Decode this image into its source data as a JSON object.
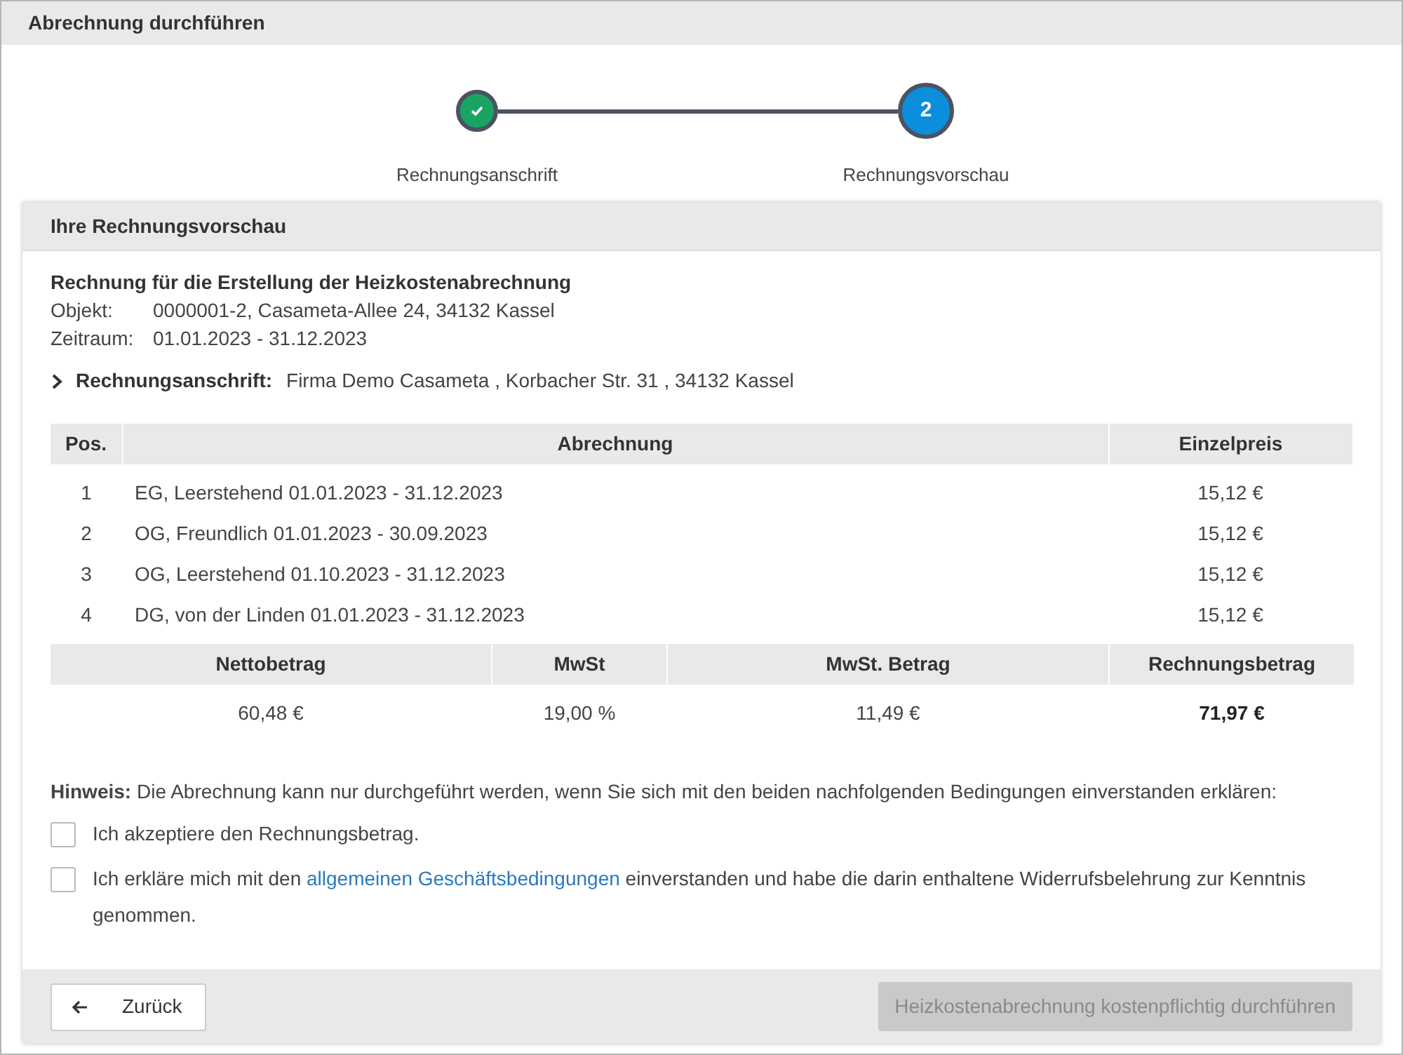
{
  "window": {
    "title": "Abrechnung durchführen"
  },
  "steps": [
    {
      "label": "Rechnungsanschrift",
      "completed": true
    },
    {
      "label": "Rechnungsvorschau",
      "completed": false,
      "number": "2"
    }
  ],
  "panel": {
    "title": "Ihre Rechnungsvorschau",
    "heading": "Rechnung für die Erstellung der Heizkostenabrechnung",
    "details": [
      {
        "label": "Objekt:",
        "value": "0000001-2, Casameta-Allee 24, 34132 Kassel"
      },
      {
        "label": "Zeitraum:",
        "value": "01.01.2023 - 31.12.2023"
      }
    ],
    "address": {
      "label": "Rechnungsanschrift:",
      "value": "Firma Demo Casameta , Korbacher Str. 31 , 34132 Kassel",
      "expanded": false
    }
  },
  "table": {
    "columns": [
      "Pos.",
      "Abrechnung",
      "Einzelpreis"
    ],
    "rows": [
      [
        "1",
        "EG, Leerstehend 01.01.2023 - 31.12.2023",
        "15,12 €"
      ],
      [
        "2",
        "OG, Freundlich 01.01.2023 - 30.09.2023",
        "15,12 €"
      ],
      [
        "3",
        "OG, Leerstehend 01.10.2023 - 31.12.2023",
        "15,12 €"
      ],
      [
        "4",
        "DG, von der Linden 01.01.2023 - 31.12.2023",
        "15,12 €"
      ]
    ]
  },
  "summary": {
    "columns": [
      "Nettobetrag",
      "MwSt",
      "MwSt. Betrag",
      "Rechnungsbetrag"
    ],
    "values": [
      "60,48 €",
      "19,00 %",
      "11,49 €",
      "71,97 €"
    ]
  },
  "note": "**Hinweis:** Die Abrechnung kann nur durchgeführt werden, wenn Sie sich mit den beiden nachfolgenden Bedingungen einverstanden erklären:",
  "conditions": [
    {
      "text": "Ich akzeptiere den Rechnungsbetrag.",
      "checked": false
    },
    {
      "text": "Ich erkläre mich mit den",
      "link": "allgemeinen Geschäftsbedingungen",
      "text_after": "einverstanden und habe die darin enthaltene Widerrufsbelehrung zur Kenntnis genommen.",
      "checked": false
    }
  ],
  "buttons": {
    "back": "Zurück",
    "submit": {
      "label": "Heizkostenabrechnung kostenpflichtig durchführen",
      "disabled": true
    }
  }
}
